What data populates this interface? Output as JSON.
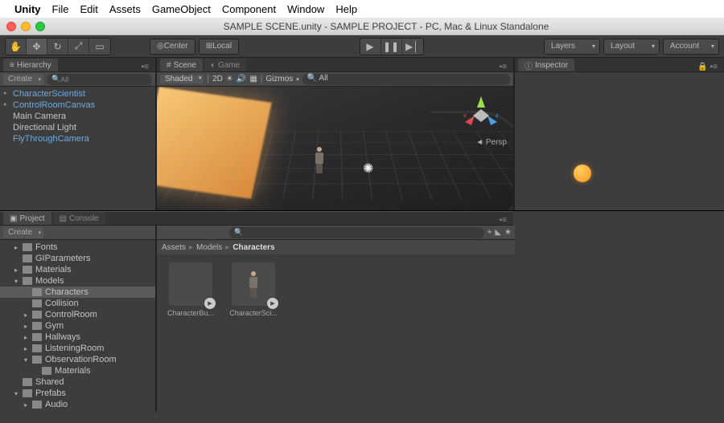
{
  "mac_menu": {
    "app": "Unity",
    "items": [
      "File",
      "Edit",
      "Assets",
      "GameObject",
      "Component",
      "Window",
      "Help"
    ]
  },
  "window_title": "SAMPLE SCENE.unity - SAMPLE PROJECT - PC, Mac & Linux Standalone",
  "toolbar": {
    "pivot_center": "Center",
    "pivot_local": "Local",
    "layers": "Layers",
    "layout": "Layout",
    "account": "Account"
  },
  "hierarchy": {
    "tab": "Hierarchy",
    "create": "Create",
    "search_placeholder": "All",
    "items": [
      {
        "label": "CharacterScientist",
        "link": true,
        "expand": true
      },
      {
        "label": "ControlRoomCanvas",
        "link": true,
        "expand": true
      },
      {
        "label": "Main Camera",
        "link": false,
        "expand": false
      },
      {
        "label": "Directional Light",
        "link": false,
        "expand": false
      },
      {
        "label": "FlyThroughCamera",
        "link": true,
        "expand": false
      }
    ]
  },
  "scene": {
    "tab_scene": "Scene",
    "tab_game": "Game",
    "shaded": "Shaded",
    "twoD": "2D",
    "gizmos": "Gizmos",
    "search_placeholder": "All",
    "persp": "Persp"
  },
  "inspector": {
    "tab": "Inspector"
  },
  "project": {
    "tab_project": "Project",
    "tab_console": "Console",
    "create": "Create",
    "breadcrumb": [
      "Assets",
      "Models",
      "Characters"
    ],
    "tree": [
      {
        "d": 1,
        "label": "Fonts",
        "exp": "▸"
      },
      {
        "d": 1,
        "label": "GIParameters",
        "exp": ""
      },
      {
        "d": 1,
        "label": "Materials",
        "exp": "▸"
      },
      {
        "d": 1,
        "label": "Models",
        "exp": "▾"
      },
      {
        "d": 2,
        "label": "Characters",
        "exp": "",
        "sel": true
      },
      {
        "d": 2,
        "label": "Collision",
        "exp": ""
      },
      {
        "d": 2,
        "label": "ControlRoom",
        "exp": "▸"
      },
      {
        "d": 2,
        "label": "Gym",
        "exp": "▸"
      },
      {
        "d": 2,
        "label": "Hallways",
        "exp": "▸"
      },
      {
        "d": 2,
        "label": "ListeningRoom",
        "exp": "▸"
      },
      {
        "d": 2,
        "label": "ObservationRoom",
        "exp": "▾"
      },
      {
        "d": 3,
        "label": "Materials",
        "exp": ""
      },
      {
        "d": 1,
        "label": "Shared",
        "exp": ""
      },
      {
        "d": 1,
        "label": "Prefabs",
        "exp": "▾"
      },
      {
        "d": 2,
        "label": "Audio",
        "exp": "▸"
      }
    ],
    "assets": [
      {
        "label": "CharacterBu..."
      },
      {
        "label": "CharacterSci..."
      }
    ]
  }
}
